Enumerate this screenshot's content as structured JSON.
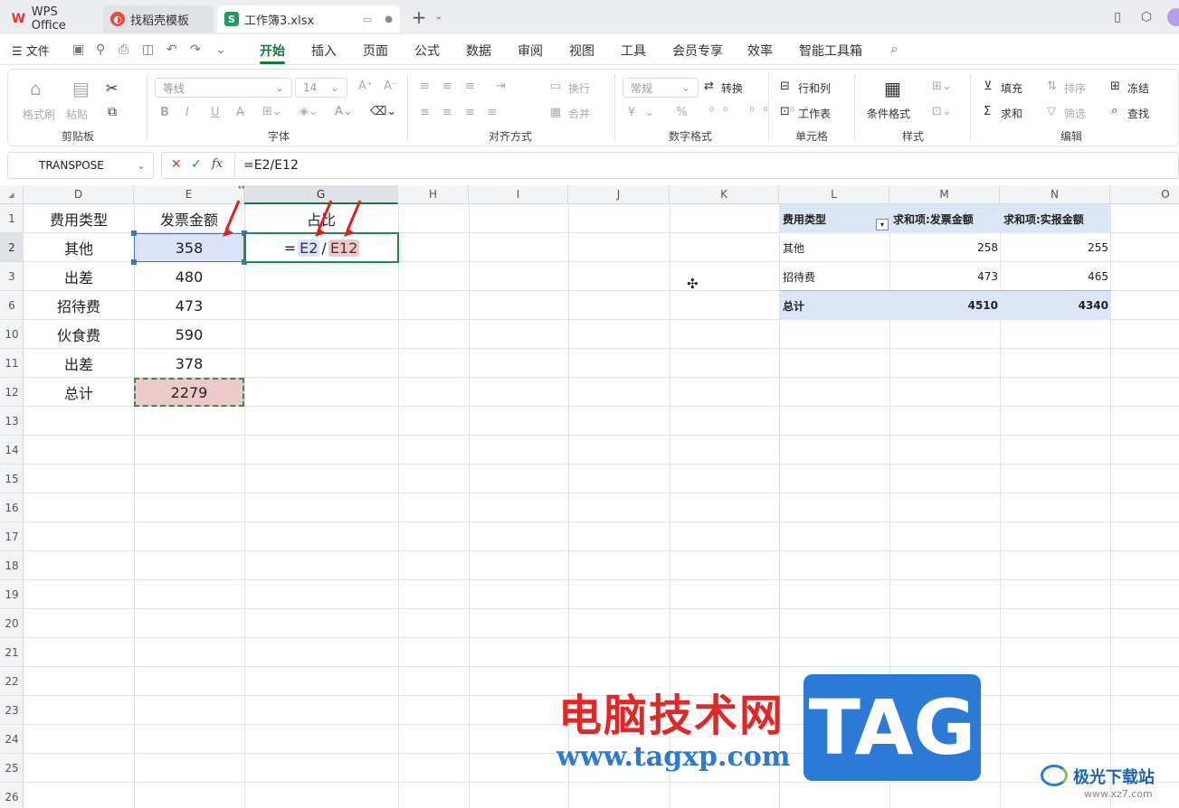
{
  "tabs": [
    {
      "label": "WPS Office",
      "icon": "wps-logo-icon"
    },
    {
      "label": "找稻壳模板",
      "icon": "daoke-icon"
    },
    {
      "label": "工作簿3.xlsx",
      "icon": "sheet-icon",
      "icon_text": "S"
    }
  ],
  "menu": {
    "file": "文件",
    "items": [
      "开始",
      "插入",
      "页面",
      "公式",
      "数据",
      "审阅",
      "视图",
      "工具",
      "会员专享",
      "效率",
      "智能工具箱"
    ],
    "active": "开始"
  },
  "ribbon": {
    "clipboard": {
      "format_painter": "格式刷",
      "paste": "粘贴",
      "group": "剪贴板"
    },
    "font": {
      "name": "等线",
      "size": "14",
      "group": "字体"
    },
    "align": {
      "wrap": "换行",
      "merge": "合并",
      "group": "对齐方式"
    },
    "number": {
      "format": "常规",
      "convert": "转换",
      "group": "数字格式"
    },
    "cells": {
      "rows_cols": "行和列",
      "worksheet": "工作表",
      "group": "单元格"
    },
    "styles": {
      "cond_format": "条件格式",
      "group": "样式"
    },
    "edit": {
      "fill": "填充",
      "sort": "排序",
      "freeze": "冻结",
      "sum": "求和",
      "filter": "筛选",
      "find": "查找",
      "group": "编辑"
    }
  },
  "formula_bar": {
    "name_box": "TRANSPOSE",
    "fx": "fx",
    "formula": "=E2/E12"
  },
  "columns": [
    "D",
    "E",
    "G",
    "H",
    "I",
    "J",
    "K",
    "L",
    "M",
    "N",
    "O"
  ],
  "rows": [
    "1",
    "2",
    "3",
    "6",
    "10",
    "11",
    "12",
    "13",
    "14",
    "15",
    "16",
    "17",
    "18",
    "19",
    "20",
    "21",
    "22",
    "23",
    "24",
    "25",
    "26"
  ],
  "table": {
    "header": {
      "type": "费用类型",
      "amount": "发票金额",
      "ratio": "占比"
    },
    "rows": [
      {
        "type": "其他",
        "amount": "358"
      },
      {
        "type": "出差",
        "amount": "480"
      },
      {
        "type": "招待费",
        "amount": "473"
      },
      {
        "type": "伙食费",
        "amount": "590"
      },
      {
        "type": "出差",
        "amount": "378"
      },
      {
        "type": "总计",
        "amount": "2279"
      }
    ],
    "edit_formula": {
      "eq": "=",
      "ref1": "E2",
      "slash": "/",
      "ref2": "E12"
    }
  },
  "pivot": {
    "headers": [
      "费用类型",
      "求和项:发票金额",
      "求和项:实报金额"
    ],
    "rows": [
      {
        "type": "其他",
        "invoice": "258",
        "reported": "255"
      },
      {
        "type": "招待费",
        "invoice": "473",
        "reported": "465"
      }
    ],
    "total": {
      "type": "总计",
      "invoice": "4510",
      "reported": "4340"
    }
  },
  "watermark": {
    "cn": "电脑技术网",
    "url": "www.tagxp.com",
    "logo": "TAG",
    "site": "极光下载站",
    "site_url": "www.xz7.com"
  },
  "colors": {
    "accent": "#127a3f",
    "sel_blue": "#dbe5f7",
    "sel_red": "#eccaca",
    "pivot_header": "#dbe7f4",
    "watermark_red": "#e02828",
    "watermark_blue": "#2a7ad6"
  }
}
